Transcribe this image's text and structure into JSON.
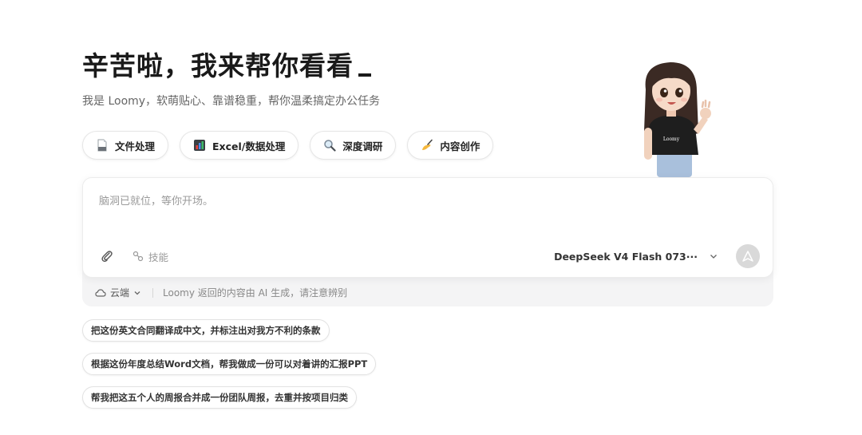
{
  "hero": {
    "title": "辛苦啦，我来帮你看看",
    "subtitle": "我是 Loomy，软萌贴心、靠谱稳重，帮你温柔搞定办公任务"
  },
  "chips": [
    {
      "label": "文件处理",
      "icon": "document-icon"
    },
    {
      "label": "Excel/数据处理",
      "icon": "bar-chart-icon"
    },
    {
      "label": "深度调研",
      "icon": "magnifier-icon"
    },
    {
      "label": "内容创作",
      "icon": "writing-hand-icon"
    }
  ],
  "input": {
    "placeholder": "脑洞已就位，等你开场。",
    "skill_label": "技能",
    "model_label": "DeepSeek V4 Flash 073···"
  },
  "footer_bar": {
    "mode_label": "云端",
    "disclaimer": "Loomy 返回的内容由 AI 生成，请注意辨别"
  },
  "suggestions": [
    "把这份英文合同翻译成中文，并标注出对我方不利的条款",
    "根据这份年度总结Word文档，帮我做成一份可以对着讲的汇报PPT",
    "帮我把这五个人的周报合并成一份团队周报，去重并按项目归类"
  ],
  "mascot": {
    "shirt_text": "Loomy"
  },
  "colors": {
    "text": "#1a1a1a",
    "muted": "#9a9a9a",
    "bar": "#f4f4f5",
    "send": "#d9d9d9"
  }
}
